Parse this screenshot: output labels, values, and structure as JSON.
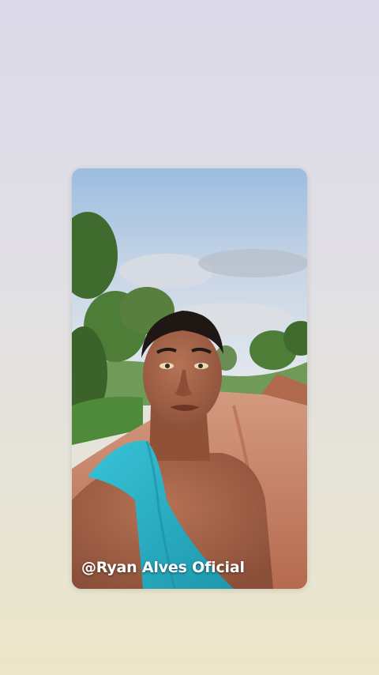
{
  "story": {
    "caption": "@Ryan Alves Oficial"
  },
  "colors": {
    "background_top": "#dcd9e8",
    "background_bottom": "#ede6c8",
    "sky": "#8fb3d6",
    "dirt_road": "#c9826a",
    "towel": "#2bb3c8",
    "skin": "#a8664a",
    "caption_text": "#ffffff"
  }
}
